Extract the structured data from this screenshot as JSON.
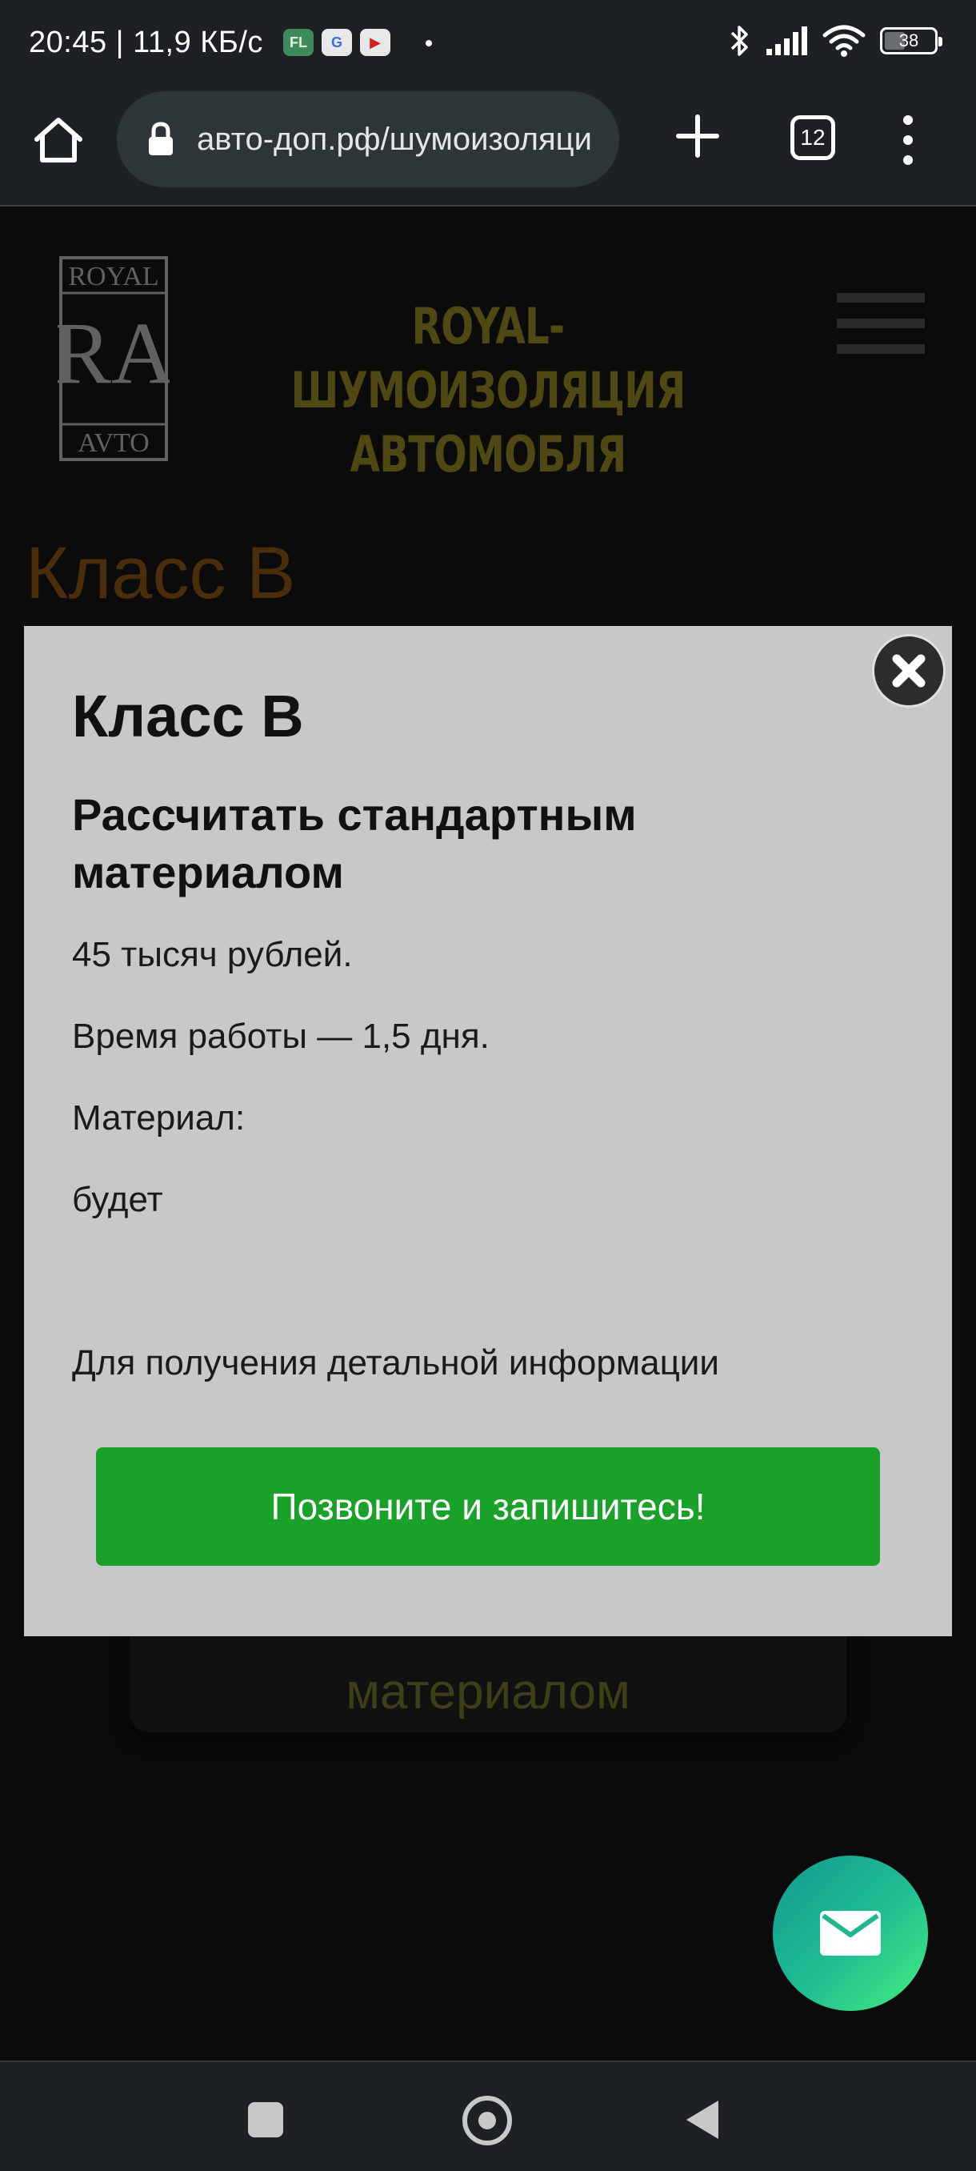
{
  "status_bar": {
    "time": "20:45 | 11,9 КБ/с",
    "app_icons": [
      "FL",
      "G",
      "▶"
    ],
    "battery": "38"
  },
  "browser": {
    "url": "авто-доп.рф/шумоизоляци",
    "tab_count": "12"
  },
  "site": {
    "logo_text_top": "ROYAL",
    "logo_monogram": "RA",
    "logo_text_bottom": "AVTO",
    "title_line1": "ROYAL-ШУМОИЗОЛЯЦИЯ",
    "title_line2": "АВТОМОБЛЯ",
    "page_heading": "Класс В",
    "bg_button_label": "материалом"
  },
  "modal": {
    "title": "Класс В",
    "subtitle": "Рассчитать стандартным материалом",
    "price": "45 тысяч рублей.",
    "duration": "Время работы — 1,5 дня.",
    "material_label": "Материал:",
    "material_value": "будет",
    "info": "Для получения детальной информации",
    "call_button": "Позвоните и запишитесь!"
  },
  "colors": {
    "modal_bg": "#c8c8c8",
    "call_button": "#1aa12a",
    "fab_gradient_start": "#139a93",
    "fab_gradient_end": "#44f07c"
  }
}
